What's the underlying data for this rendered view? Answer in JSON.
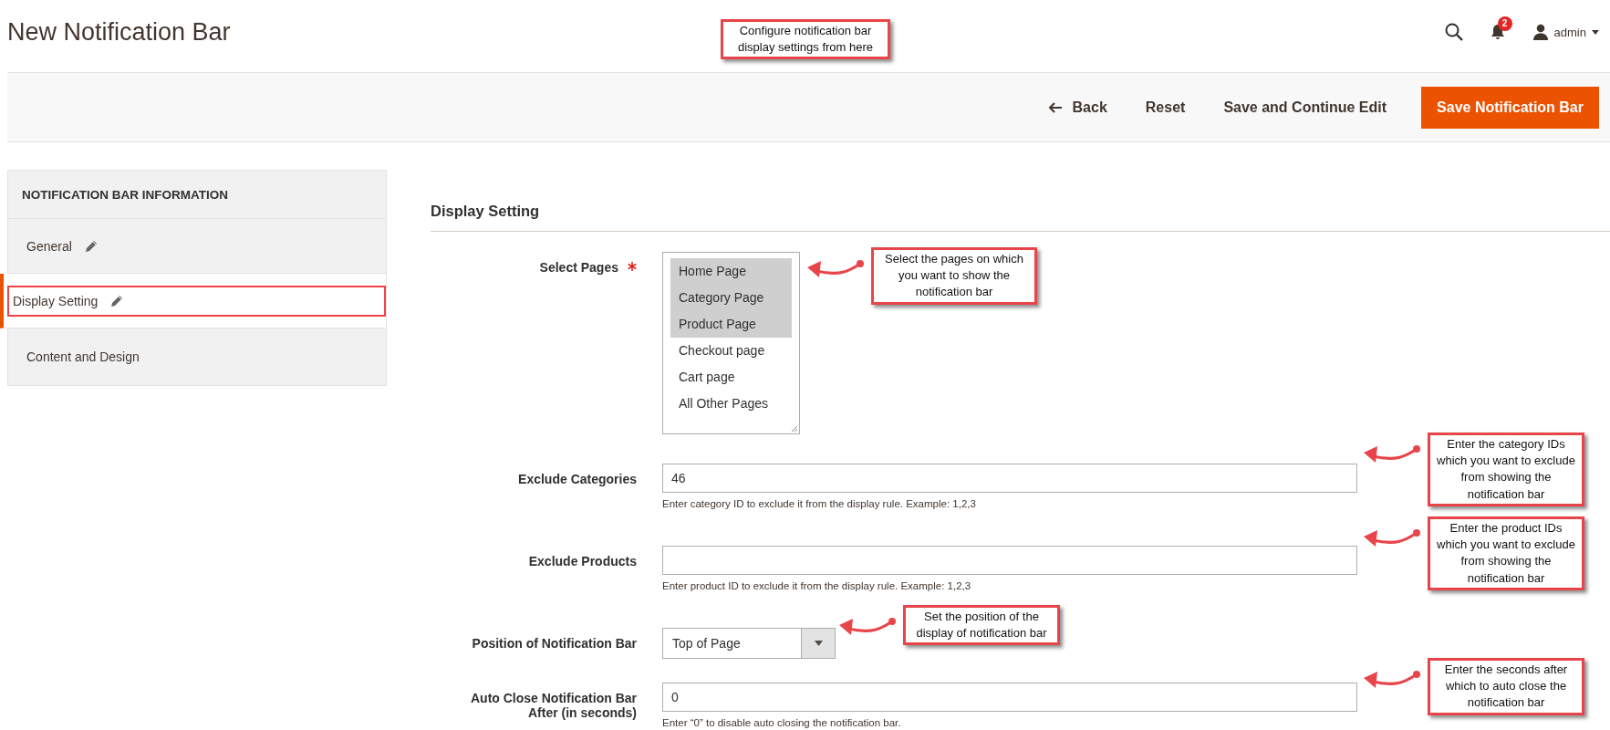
{
  "header": {
    "title": "New Notification Bar",
    "notification_count": "2",
    "user": "admin"
  },
  "actions": [
    {
      "label": "Back",
      "kind": "back"
    },
    {
      "label": "Reset",
      "kind": "plain"
    },
    {
      "label": "Save and Continue Edit",
      "kind": "plain"
    },
    {
      "label": "Save Notification Bar",
      "kind": "primary"
    }
  ],
  "sidebar": {
    "title": "NOTIFICATION BAR INFORMATION",
    "items": [
      {
        "label": "General",
        "selected": false,
        "edited": true
      },
      {
        "label": "Display Setting",
        "selected": true,
        "edited": true
      },
      {
        "label": "Content and Design",
        "selected": false,
        "edited": false
      }
    ]
  },
  "section": {
    "title": "Display Setting",
    "fields": [
      {
        "kind": "multiselect",
        "label": "Select Pages",
        "required": true,
        "options": [
          {
            "label": "Home Page",
            "selected": true
          },
          {
            "label": "Category Page",
            "selected": true
          },
          {
            "label": "Product Page",
            "selected": true
          },
          {
            "label": "Checkout page",
            "selected": false
          },
          {
            "label": "Cart page",
            "selected": false
          },
          {
            "label": "All Other Pages",
            "selected": false
          }
        ]
      },
      {
        "kind": "text",
        "label": "Exclude Categories",
        "required": false,
        "value": "46",
        "note": "Enter category ID to exclude it from the display rule. Example: 1,2,3"
      },
      {
        "kind": "text",
        "label": "Exclude Products",
        "required": false,
        "note": "Enter product ID to exclude it from the display rule. Example: 1,2,3"
      },
      {
        "kind": "select",
        "label": "Position of Notification Bar",
        "required": false,
        "value": "Top of Page"
      },
      {
        "kind": "text",
        "label": "Auto Close Notification Bar After (in seconds)",
        "required": false,
        "value": "0",
        "note": "Enter “0” to disable auto closing the notification bar."
      }
    ]
  },
  "annotations": [
    {
      "kind": "note",
      "text": "Configure notification bar display settings from here"
    },
    {
      "kind": "arrow",
      "text": "Select the pages on which you want to show the notification bar"
    },
    {
      "kind": "arrow",
      "text": "Enter the category IDs which you want to exclude from showing the notification bar"
    },
    {
      "kind": "arrow",
      "text": "Enter the product IDs which you want to exclude from showing the notification bar"
    },
    {
      "kind": "arrow",
      "text": "Set the position of the display of notification bar"
    },
    {
      "kind": "arrow",
      "text": "Enter the seconds after which to auto close the notification bar"
    }
  ]
}
